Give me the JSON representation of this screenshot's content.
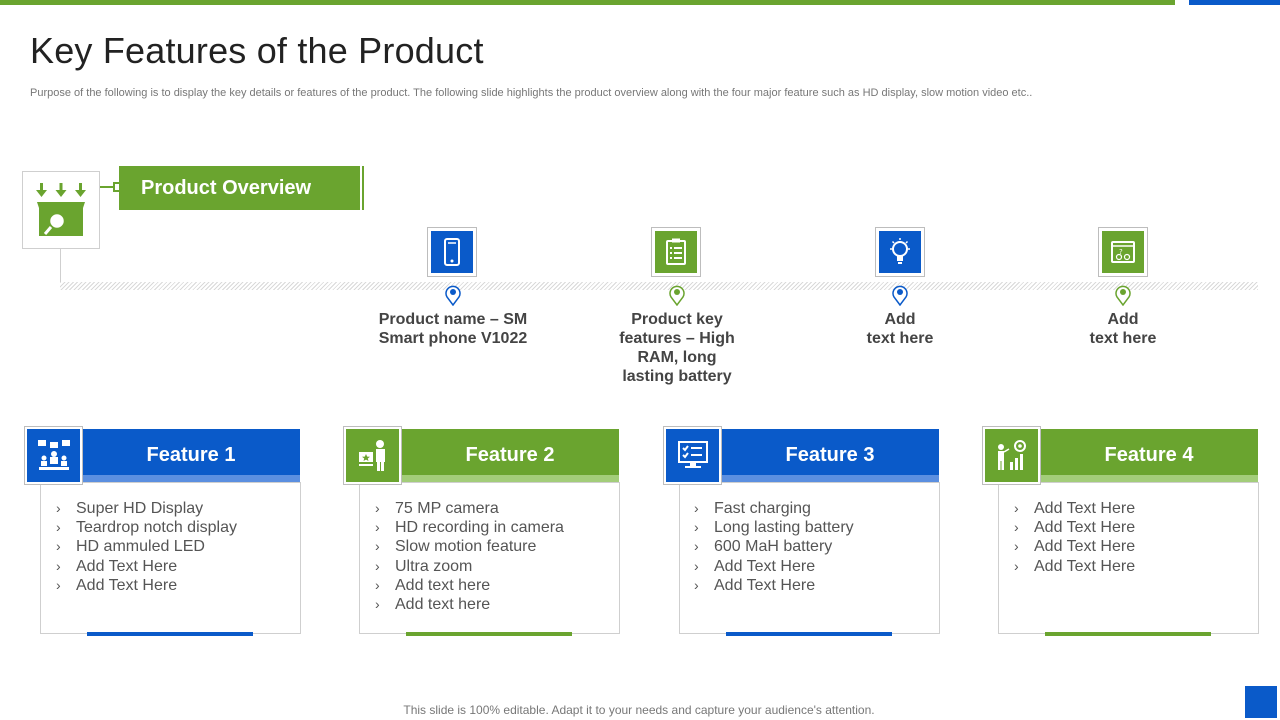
{
  "colors": {
    "green": "#6aa42f",
    "blue": "#0a5ac9",
    "text": "#444444"
  },
  "title": "Key Features of the Product",
  "subtitle": "Purpose of the following is to display the key details or features of the product. The following slide highlights the product overview along with the four major feature such as HD display, slow motion video etc..",
  "overview": {
    "label": "Product Overview",
    "icon": "box-download-search-icon"
  },
  "timeline": [
    {
      "icon": "smartphone-icon",
      "color": "blue",
      "line1": "Product name – SM",
      "line2": "Smart phone V1022",
      "line3": "",
      "line4": ""
    },
    {
      "icon": "checklist-icon",
      "color": "green",
      "line1": "Product key",
      "line2": "features – High",
      "line3": "RAM, long",
      "line4": "lasting battery"
    },
    {
      "icon": "lightbulb-icon",
      "color": "blue",
      "line1": "Add",
      "line2": "text here",
      "line3": "",
      "line4": ""
    },
    {
      "icon": "dashboard-icon",
      "color": "green",
      "line1": "Add",
      "line2": "text here",
      "line3": "",
      "line4": ""
    }
  ],
  "features": [
    {
      "title": "Feature 1",
      "icon": "team-presentation-icon",
      "color": "blue",
      "items": [
        "Super HD Display",
        "Teardrop notch display",
        "HD ammuled LED",
        "Add Text Here",
        "Add Text Here"
      ]
    },
    {
      "title": "Feature 2",
      "icon": "presenter-board-icon",
      "color": "green",
      "items": [
        "75 MP camera",
        "HD recording in camera",
        "Slow motion feature",
        "Ultra zoom",
        "Add text here",
        "Add text here"
      ]
    },
    {
      "title": "Feature 3",
      "icon": "monitor-checklist-icon",
      "color": "blue",
      "items": [
        "Fast charging",
        "Long lasting battery",
        "600 MaH battery",
        "Add Text Here",
        "Add Text Here"
      ]
    },
    {
      "title": "Feature 4",
      "icon": "growth-target-icon",
      "color": "green",
      "items": [
        "Add Text Here",
        "Add Text Here",
        "Add Text Here",
        "Add Text Here"
      ]
    }
  ],
  "footer": "This slide is 100% editable. Adapt it to your needs and capture your audience's attention."
}
